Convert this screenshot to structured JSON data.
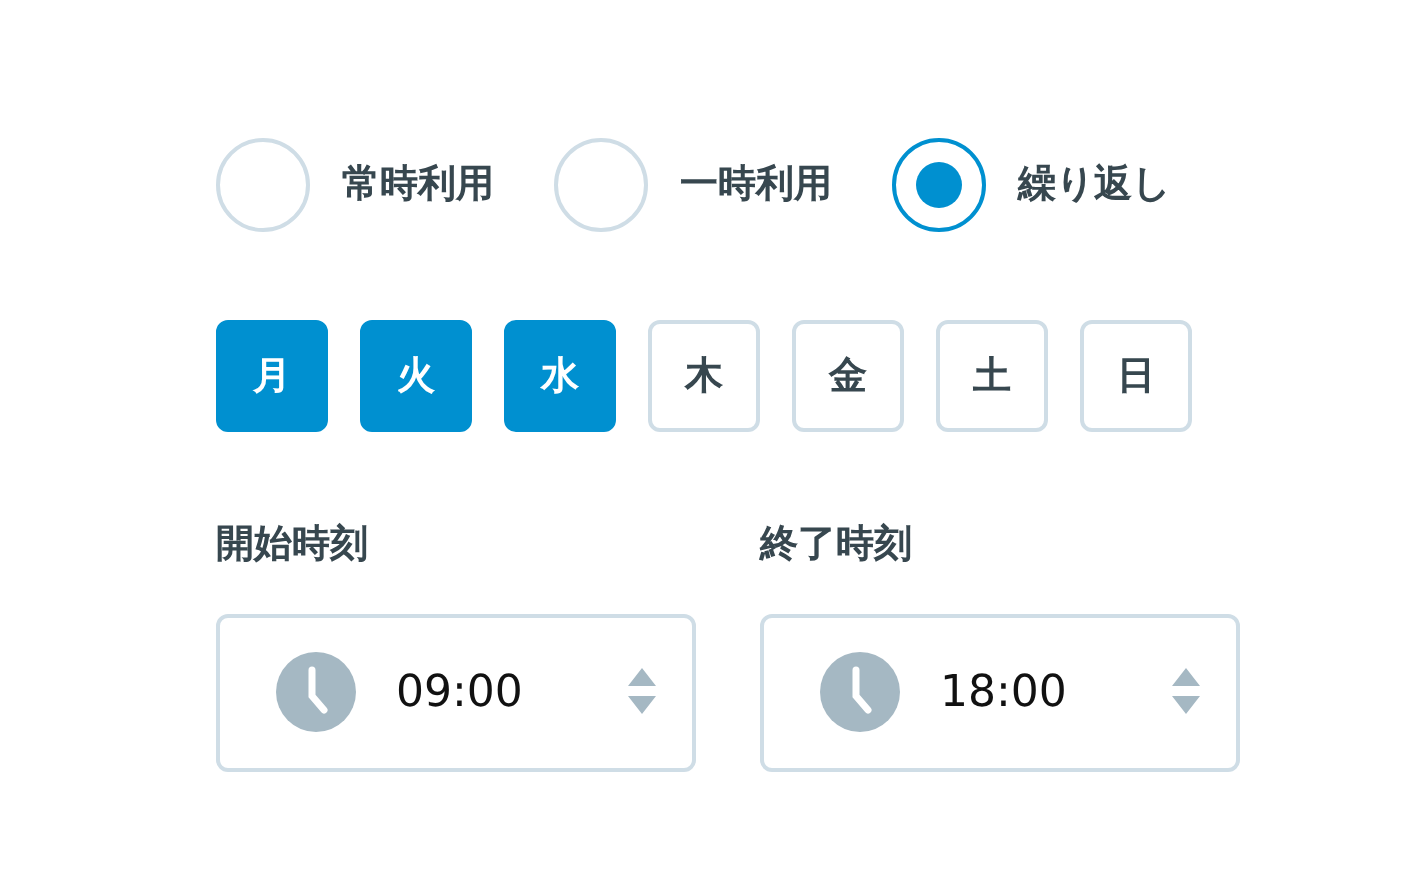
{
  "usage_options": [
    {
      "label": "常時利用",
      "selected": false
    },
    {
      "label": "一時利用",
      "selected": false
    },
    {
      "label": "繰り返し",
      "selected": true
    }
  ],
  "weekdays": [
    {
      "label": "月",
      "selected": true
    },
    {
      "label": "火",
      "selected": true
    },
    {
      "label": "水",
      "selected": true
    },
    {
      "label": "木",
      "selected": false
    },
    {
      "label": "金",
      "selected": false
    },
    {
      "label": "土",
      "selected": false
    },
    {
      "label": "日",
      "selected": false
    }
  ],
  "time_fields": [
    {
      "label": "開始時刻",
      "value": "09:00"
    },
    {
      "label": "終了時刻",
      "value": "18:00"
    }
  ]
}
